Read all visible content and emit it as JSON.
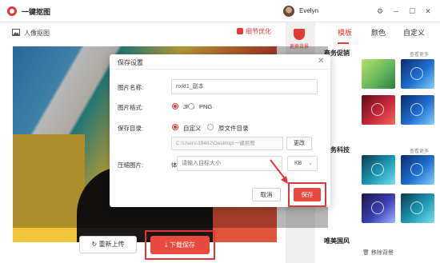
{
  "titlebar": {
    "app_name": "一键抠图",
    "username": "Evelyn",
    "controls": [
      "⚙",
      "─",
      "☐",
      "✕"
    ]
  },
  "workspace": {
    "breadcrumb": "人像抠图",
    "detail_label": "细节优化",
    "reupload_label": "重新上传",
    "download_label": "下载保存",
    "bg_change_label": "更换背景"
  },
  "right_panel": {
    "tabs": [
      "模板",
      "颜色",
      "自定义"
    ],
    "active_tab": 0,
    "sections": [
      {
        "title": "商务促销",
        "more": "查看更多"
      },
      {
        "title": "商务科技",
        "more": "查看更多"
      },
      {
        "title": "唯美国风",
        "more": ""
      }
    ],
    "remove_bg_label": "移除背景"
  },
  "dialog": {
    "title": "保存设置",
    "name_label": "图片名称:",
    "name_value": "nxkt1_副本",
    "format_label": "图片格式:",
    "format_options": [
      "JPG",
      "PNG"
    ],
    "format_selected": "JPG",
    "dir_label": "保存目录:",
    "dir_options": [
      "自定义",
      "原文件目录"
    ],
    "dir_selected": "自定义",
    "path_value": "C:\\Users\\19482\\Desktop\\一键抠图",
    "change_label": "更改",
    "compress_label": "压缩图片:",
    "size_prefix": "体积小于",
    "size_placeholder": "请输入目标大小",
    "unit": "KB",
    "cancel_label": "取消",
    "save_label": "保存"
  },
  "colors": {
    "accent": "#e84a3f",
    "highlight_box": "#e2363a"
  },
  "icons": {
    "logo": "logo-ring-icon",
    "home": "image-icon",
    "detail": "brush-icon",
    "bg": "paint-bucket-icon",
    "close": "close-icon",
    "dropdown": "chevron-down-icon",
    "reupload": "refresh-icon",
    "download": "download-icon",
    "remove": "trash-icon"
  }
}
